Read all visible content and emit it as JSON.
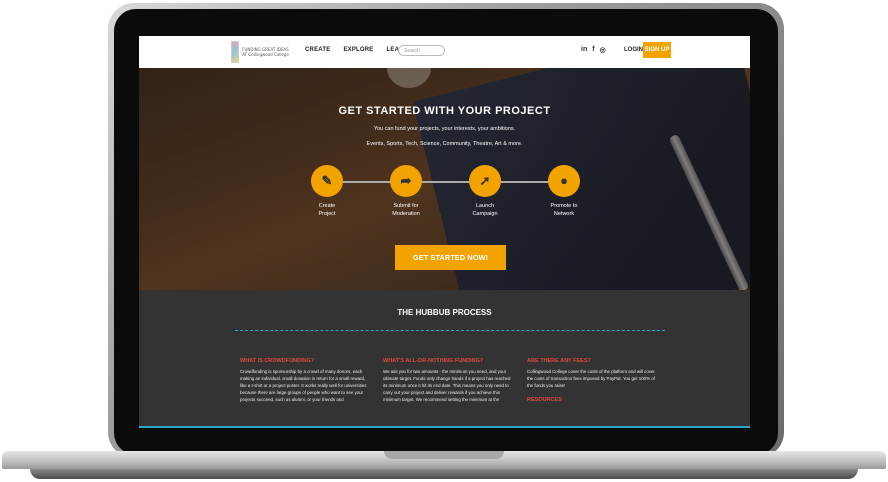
{
  "nav": {
    "logo_text": "FUNDING GREAT IDEAS AT Collingwood College",
    "menu": [
      "CREATE",
      "EXPLORE",
      "LEARN"
    ],
    "search_placeholder": "Search",
    "social": [
      "in",
      "f",
      "◎"
    ],
    "login": "LOGIN",
    "signup": "SIGN UP"
  },
  "hero": {
    "title": "GET STARTED WITH YOUR PROJECT",
    "subtitle": "You can fund your projects, your interests, your ambitions.",
    "subtitle2": "Events, Sports, Tech, Science, Community, Theatre, Art & more.",
    "steps": [
      {
        "icon": "edit-icon",
        "glyph": "✎",
        "label": "Create\nProject"
      },
      {
        "icon": "share-arrow-icon",
        "glyph": "➦",
        "label": "Submit for\nModeration"
      },
      {
        "icon": "rocket-icon",
        "glyph": "➚",
        "label": "Launch\nCampaign"
      },
      {
        "icon": "chat-bubble-icon",
        "glyph": "●",
        "label": "Promote to\nNetwork"
      }
    ],
    "cta": "GET STARTED NOW!"
  },
  "process": {
    "title": "THE HUBBUB PROCESS",
    "columns": [
      {
        "heading": "WHAT IS CROWDFUNDING?",
        "body": "Crowdfunding is sponsorship by a crowd of many donors, each making an individual, small donation in return for a small reward, like a t-shirt or a project poster. It works really well for universities because there are large groups of people who want to see your projects succeed, such as alumni, or your friends and"
      },
      {
        "heading": "WHAT'S ALL-OR-NOTHING FUNDING?",
        "body": "We ask you for two amounts - the minimum you need, and your ultimate target. Funds only change hands if a project has reached its minimum once it hit its end date. This means you only need to carry out your project and deliver rewards if you achieve this minimum target. We recommend setting the minimum at the"
      },
      {
        "heading": "ARE THERE ANY FEES?",
        "body": "Collingwood College cover the costs of the platform and will cover the costs of transaction fees imposed by PayPal. You get 100% of the funds you raise!",
        "subheading": "RESOURCES"
      }
    ]
  },
  "colors": {
    "accent": "#f2a300",
    "heading_red": "#e04a3a",
    "divider": "#29a6c4",
    "dark_bg": "#333333"
  }
}
